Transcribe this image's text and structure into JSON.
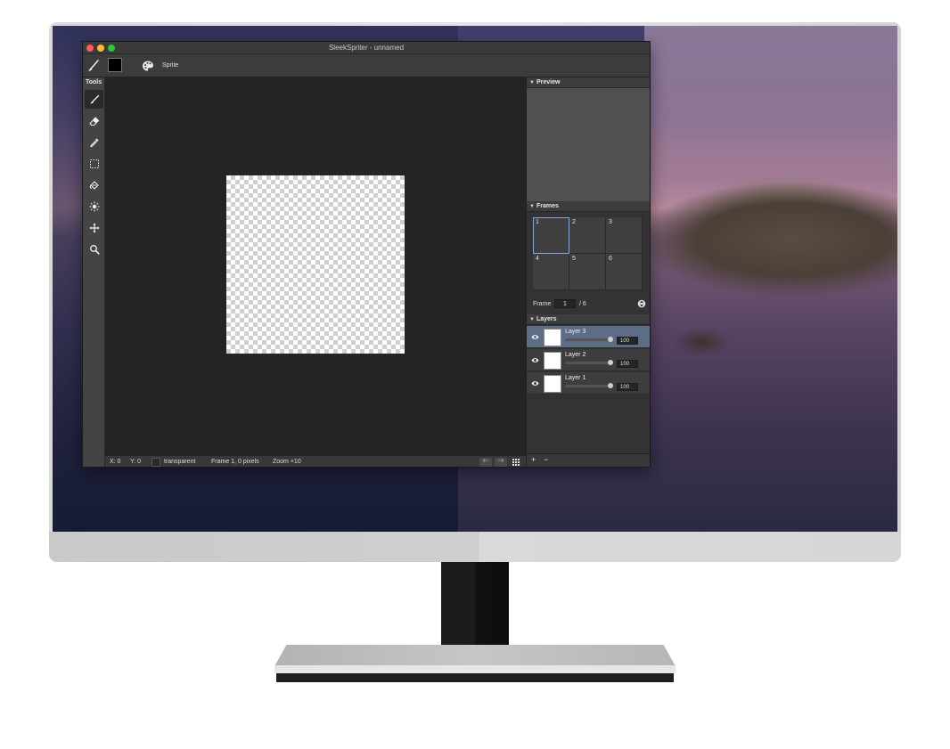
{
  "window": {
    "title": "SleekSpriter - unnamed"
  },
  "toolbar": {
    "mode_label": "Sprite",
    "color": "#000000"
  },
  "tools": {
    "title": "Tools",
    "items": [
      {
        "name": "brush-icon",
        "active": true
      },
      {
        "name": "eraser-icon",
        "active": false
      },
      {
        "name": "eyedropper-icon",
        "active": false
      },
      {
        "name": "selection-icon",
        "active": false
      },
      {
        "name": "fill-icon",
        "active": false
      },
      {
        "name": "brightness-icon",
        "active": false
      },
      {
        "name": "move-icon",
        "active": false
      },
      {
        "name": "zoom-icon",
        "active": false
      }
    ]
  },
  "status": {
    "x": "X: 0",
    "y": "Y: 0",
    "color_name": "transparent",
    "frame_info": "Frame 1, 0 pixels",
    "zoom": "Zoom ×10"
  },
  "preview": {
    "title": "Preview"
  },
  "frames": {
    "title": "Frames",
    "cells": [
      "1",
      "2",
      "3",
      "4",
      "5",
      "6"
    ],
    "selected": "1",
    "frame_label": "Frame",
    "current": "1",
    "total": "/ 6"
  },
  "layers": {
    "title": "Layers",
    "items": [
      {
        "name": "Layer 3",
        "opacity": "100",
        "selected": true
      },
      {
        "name": "Layer 2",
        "opacity": "100",
        "selected": false
      },
      {
        "name": "Layer 1",
        "opacity": "100",
        "selected": false
      }
    ],
    "add_label": "+",
    "remove_label": "−"
  },
  "colors": {
    "accent_selection": "#5d6d86",
    "frame_highlight": "#8aa6d8"
  }
}
